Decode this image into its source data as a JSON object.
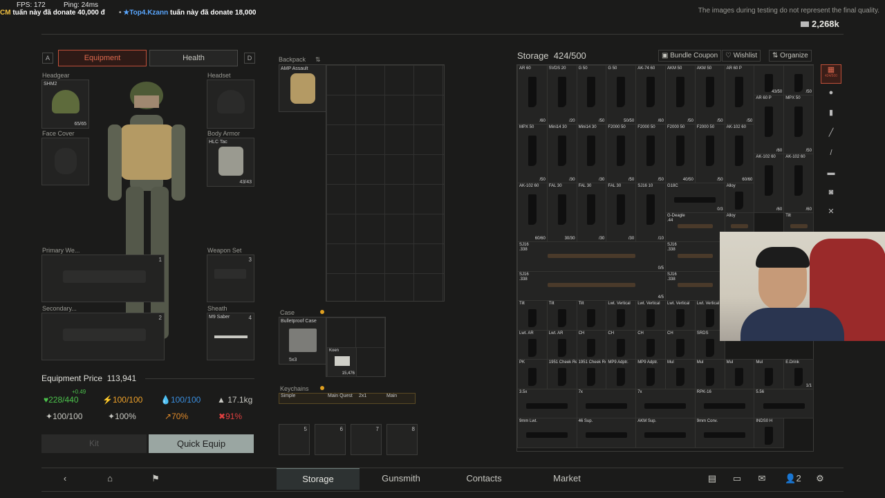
{
  "overlay": {
    "fps": "FPS: 172",
    "ping": "Ping: 24ms",
    "donate1_prefix": "CM",
    "donate1_text": "tuấn này đã donate 40,000 đ",
    "donate2_star": "★",
    "donate2_name": "Top4.Kzann",
    "donate2_text": "tuấn này đã donate 18,000",
    "disclaimer": "The images during testing do not represent the final quality.",
    "roubles": "2,268k"
  },
  "tabs": {
    "left_key": "A",
    "equipment": "Equipment",
    "health": "Health",
    "right_key": "D"
  },
  "equipment": {
    "headgear": {
      "label": "Headgear",
      "item": "SHM2",
      "durability": "65/65"
    },
    "headset": {
      "label": "Headset"
    },
    "face_cover": {
      "label": "Face Cover"
    },
    "body_armor": {
      "label": "Body Armor",
      "item": "HLC Tac",
      "durability": "43/43"
    },
    "primary": {
      "label": "Primary We...",
      "num": "1"
    },
    "weapon_set": {
      "label": "Weapon Set",
      "num": "3"
    },
    "secondary": {
      "label": "Secondary...",
      "num": "2"
    },
    "sheath": {
      "label": "Sheath",
      "item": "M9 Saber",
      "num": "4"
    }
  },
  "backpack": {
    "label": "Backpack",
    "item": "AMP Assault"
  },
  "case": {
    "label": "Case",
    "item": "Bulletproof Case",
    "size": "5x3",
    "inner_item": "Koen",
    "inner_count": "15,476"
  },
  "keychains": {
    "label": "Keychains",
    "item": "Simple",
    "slot1": "Main Quest",
    "slot2": "2x1",
    "slot3": "Main"
  },
  "quickslots": [
    "5",
    "6",
    "7",
    "8"
  ],
  "price": {
    "label": "Equipment Price",
    "value": "113,941"
  },
  "stats": {
    "health": "228/440",
    "health_delta": "+0.49",
    "energy": "100/100",
    "hydration": "100/100",
    "weight": "17.1kg",
    "stat_a": "100/100",
    "stat_b": "100%",
    "stat_c": "70%",
    "stat_d": "91%"
  },
  "buttons": {
    "kit": "Kit",
    "quick_equip": "Quick Equip"
  },
  "storage": {
    "title": "Storage",
    "capacity": "424/500",
    "bundle_coupon": "Bundle Coupon",
    "wishlist": "Wishlist",
    "organize": "Organize",
    "side_badge": "424/500"
  },
  "items": [
    {
      "l": "AR 60",
      "c": "/60"
    },
    {
      "l": "SVDS 20",
      "c": "/20"
    },
    {
      "l": "G 50",
      "c": "/50"
    },
    {
      "l": "G 50",
      "c": "50/50"
    },
    {
      "l": "AK-74 60",
      "c": "/60"
    },
    {
      "l": "AKM 50",
      "c": "/50"
    },
    {
      "l": "AKM 50",
      "c": "/50"
    },
    {
      "l": "AR 60 P",
      "c": "/50"
    },
    {
      "l": "",
      "c": "43/50"
    },
    {
      "l": "",
      "c": "/50"
    },
    {
      "l": "MPX 50",
      "c": "/50"
    },
    {
      "l": "Mini14 30",
      "c": "/30"
    },
    {
      "l": "Mini14 30",
      "c": "/30"
    },
    {
      "l": "F2000 50",
      "c": "/50"
    },
    {
      "l": "F2000 50",
      "c": "/50"
    },
    {
      "l": "F2000 50",
      "c": "40/50"
    },
    {
      "l": "F2000 50",
      "c": "/50"
    },
    {
      "l": "AK-102 60",
      "c": "60/60"
    },
    {
      "l": "AR 60 P",
      "c": "/60"
    },
    {
      "l": "MPX 50",
      "c": "/50"
    },
    {
      "l": "AK-102 60",
      "c": "60/60"
    },
    {
      "l": "FAL 30",
      "c": "30/30"
    },
    {
      "l": "FAL 30",
      "c": "/30"
    },
    {
      "l": "FAL 30",
      "c": "/30"
    },
    {
      "l": "SJ16 10",
      "c": "/10"
    },
    {
      "l": "G18C",
      "c": "0/3"
    },
    {
      "l": "Alloy",
      "c": ""
    },
    {
      "l": "AK-102 60",
      "c": "/60"
    },
    {
      "l": "AK-102 60",
      "c": "/60"
    },
    {
      "l": "Tilt",
      "c": ""
    },
    {
      "l": "Tilt",
      "c": ""
    },
    {
      "l": "Tilt",
      "c": ""
    },
    {
      "l": "Lwt. Vertical",
      "c": ""
    },
    {
      "l": "Lwt. Vertical",
      "c": ""
    },
    {
      "l": "Lwt. Vertical",
      "c": ""
    },
    {
      "l": "Lwt. Vertical",
      "c": ""
    },
    {
      "l": "Lwt. AR",
      "c": ""
    },
    {
      "l": "Lwt. AR",
      "c": ""
    },
    {
      "l": "CH",
      "c": ""
    },
    {
      "l": "CH",
      "c": ""
    },
    {
      "l": "CH",
      "c": ""
    },
    {
      "l": "CH",
      "c": ""
    },
    {
      "l": "SRDS",
      "c": ""
    },
    {
      "l": "PK",
      "c": ""
    },
    {
      "l": "1951 Cheek Rest",
      "c": ""
    },
    {
      "l": "1951 Cheek Rest",
      "c": ""
    },
    {
      "l": "MP9 Adptr.",
      "c": ""
    },
    {
      "l": "MP9 Adptr.",
      "c": ""
    },
    {
      "l": "Mul",
      "c": ""
    },
    {
      "l": "Mul",
      "c": ""
    },
    {
      "l": "Mul",
      "c": ""
    },
    {
      "l": "Mul",
      "c": ""
    },
    {
      "l": "E.Drink",
      "c": "1/1"
    },
    {
      "l": "3.5x",
      "c": ""
    },
    {
      "l": "7x",
      "c": ""
    },
    {
      "l": "7x",
      "c": ""
    },
    {
      "l": "RPK-16",
      "c": ""
    },
    {
      "l": "5.56",
      "c": ""
    },
    {
      "l": "9mm Lwt.",
      "c": ""
    },
    {
      "l": "46 Sup.",
      "c": ""
    },
    {
      "l": "AKM Sup.",
      "c": ""
    },
    {
      "l": "9mm Conv.",
      "c": ""
    },
    {
      "l": "INDS0 H",
      "c": ""
    }
  ],
  "long_items": [
    {
      "l": "SJ16",
      "sub": ".338",
      "c": "0/5"
    },
    {
      "l": "SJ16",
      "sub": ".338",
      "c": "4/5"
    },
    {
      "l": "G-Deagle",
      "sub": ".44",
      "c": "8/"
    },
    {
      "l": "Alloy",
      "c": ""
    },
    {
      "l": "Tilt",
      "c": ""
    },
    {
      "l": "SJ16",
      "sub": ".338",
      "c": ""
    },
    {
      "l": "SJ16",
      "sub": ".338",
      "c": ""
    }
  ],
  "nav": {
    "storage": "Storage",
    "gunsmith": "Gunsmith",
    "contacts": "Contacts",
    "market": "Market",
    "friends_count": "2"
  },
  "colors": {
    "accent": "#c0503a",
    "health": "#4cc24c",
    "energy": "#f0a22a",
    "hydration": "#3a8fe0",
    "warn": "#e08a2a",
    "danger": "#e04040"
  }
}
